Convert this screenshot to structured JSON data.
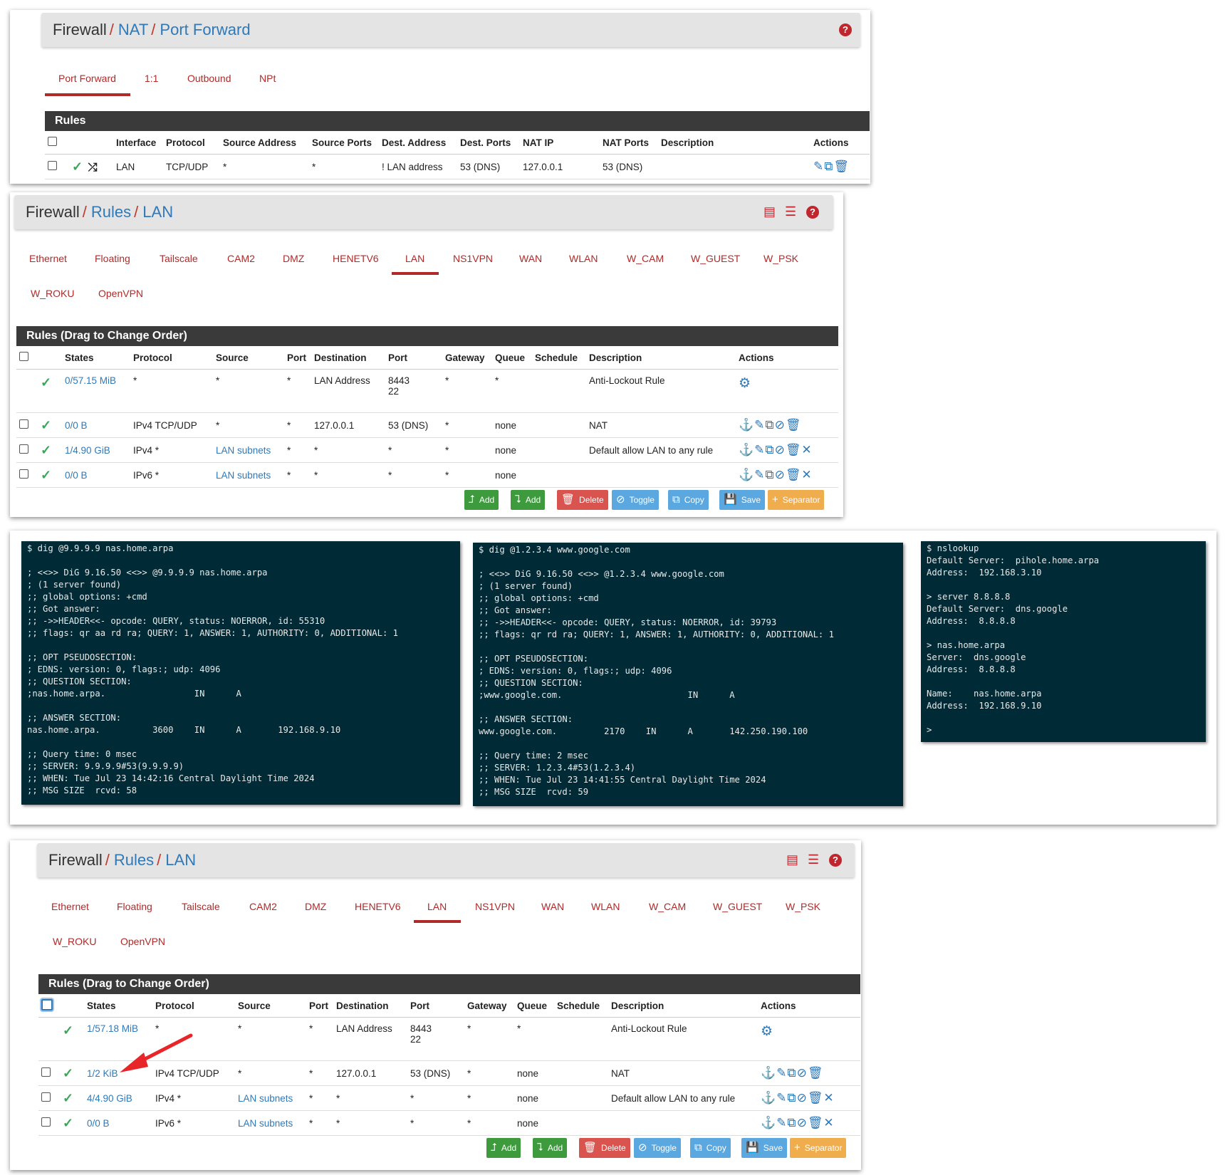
{
  "nat": {
    "crumb": {
      "c1": "Firewall",
      "sep": "/",
      "c2": "NAT",
      "c3": "Port Forward"
    },
    "help": "?",
    "tabs": [
      "Port Forward",
      "1:1",
      "Outbound",
      "NPt"
    ],
    "bar": "Rules",
    "headers": [
      "Interface",
      "Protocol",
      "Source Address",
      "Source Ports",
      "Dest. Address",
      "Dest. Ports",
      "NAT IP",
      "NAT Ports",
      "Description",
      "Actions"
    ],
    "row": {
      "interface": "LAN",
      "protocol": "TCP/UDP",
      "src": "*",
      "sports": "*",
      "dest": "! LAN address",
      "dports": "53 (DNS)",
      "natip": "127.0.0.1",
      "natports": "53 (DNS)",
      "desc": ""
    }
  },
  "lan1": {
    "crumb": {
      "c1": "Firewall",
      "sep": "/",
      "c2": "Rules",
      "c3": "LAN"
    },
    "help": "?",
    "tabs_row1": [
      "Ethernet",
      "Floating",
      "Tailscale",
      "CAM2",
      "DMZ",
      "HENETV6",
      "LAN",
      "NS1VPN",
      "WAN",
      "WLAN",
      "W_CAM",
      "W_GUEST",
      "W_PSK"
    ],
    "tabs_row2": [
      "W_ROKU",
      "OpenVPN"
    ],
    "bar": "Rules (Drag to Change Order)",
    "headers": [
      "States",
      "Protocol",
      "Source",
      "Port",
      "Destination",
      "Port",
      "Gateway",
      "Queue",
      "Schedule",
      "Description",
      "Actions"
    ],
    "rows": [
      {
        "states": "0/57.15 MiB",
        "proto": "*",
        "src": "*",
        "sport": "*",
        "dest": "LAN Address",
        "dport": "8443",
        "dport2": "22",
        "gw": "*",
        "queue": "*",
        "sched": "",
        "desc": "Anti-Lockout Rule"
      },
      {
        "states": "0/0 B",
        "proto": "IPv4 TCP/UDP",
        "src": "*",
        "sport": "*",
        "dest": "127.0.0.1",
        "dport": "53 (DNS)",
        "gw": "*",
        "queue": "none",
        "sched": "",
        "desc": "NAT"
      },
      {
        "states": "1/4.90 GiB",
        "proto": "IPv4 *",
        "src": "LAN subnets",
        "sport": "*",
        "dest": "*",
        "dport": "*",
        "gw": "*",
        "queue": "none",
        "sched": "",
        "desc": "Default allow LAN to any rule"
      },
      {
        "states": "0/0 B",
        "proto": "IPv6 *",
        "src": "LAN subnets",
        "sport": "*",
        "dest": "*",
        "dport": "*",
        "gw": "*",
        "queue": "none",
        "sched": "",
        "desc": ""
      }
    ],
    "buttons": [
      "Add",
      "Add",
      "Delete",
      "Toggle",
      "Copy",
      "Save",
      "Separator"
    ]
  },
  "term1": [
    "$ dig @9.9.9.9 nas.home.arpa",
    "",
    "; <<>> DiG 9.16.50 <<>> @9.9.9.9 nas.home.arpa",
    "; (1 server found)",
    ";; global options: +cmd",
    ";; Got answer:",
    ";; ->>HEADER<<- opcode: QUERY, status: NOERROR, id: 55310",
    ";; flags: qr aa rd ra; QUERY: 1, ANSWER: 1, AUTHORITY: 0, ADDITIONAL: 1",
    "",
    ";; OPT PSEUDOSECTION:",
    "; EDNS: version: 0, flags:; udp: 4096",
    ";; QUESTION SECTION:",
    ";nas.home.arpa.                 IN      A",
    "",
    ";; ANSWER SECTION:",
    "nas.home.arpa.          3600    IN      A       192.168.9.10",
    "",
    ";; Query time: 0 msec",
    ";; SERVER: 9.9.9.9#53(9.9.9.9)",
    ";; WHEN: Tue Jul 23 14:42:16 Central Daylight Time 2024",
    ";; MSG SIZE  rcvd: 58"
  ],
  "term2": [
    "$ dig @1.2.3.4 www.google.com",
    "",
    "; <<>> DiG 9.16.50 <<>> @1.2.3.4 www.google.com",
    "; (1 server found)",
    ";; global options: +cmd",
    ";; Got answer:",
    ";; ->>HEADER<<- opcode: QUERY, status: NOERROR, id: 39793",
    ";; flags: qr rd ra; QUERY: 1, ANSWER: 1, AUTHORITY: 0, ADDITIONAL: 1",
    "",
    ";; OPT PSEUDOSECTION:",
    "; EDNS: version: 0, flags:; udp: 4096",
    ";; QUESTION SECTION:",
    ";www.google.com.                        IN      A",
    "",
    ";; ANSWER SECTION:",
    "www.google.com.         2170    IN      A       142.250.190.100",
    "",
    ";; Query time: 2 msec",
    ";; SERVER: 1.2.3.4#53(1.2.3.4)",
    ";; WHEN: Tue Jul 23 14:41:55 Central Daylight Time 2024",
    ";; MSG SIZE  rcvd: 59"
  ],
  "term3": [
    "$ nslookup",
    "Default Server:  pihole.home.arpa",
    "Address:  192.168.3.10",
    "",
    "> server 8.8.8.8",
    "Default Server:  dns.google",
    "Address:  8.8.8.8",
    "",
    "> nas.home.arpa",
    "Server:  dns.google",
    "Address:  8.8.8.8",
    "",
    "Name:    nas.home.arpa",
    "Address:  192.168.9.10",
    "",
    ">"
  ],
  "lan2": {
    "crumb": {
      "c1": "Firewall",
      "sep": "/",
      "c2": "Rules",
      "c3": "LAN"
    },
    "help": "?",
    "tabs_row1": [
      "Ethernet",
      "Floating",
      "Tailscale",
      "CAM2",
      "DMZ",
      "HENETV6",
      "LAN",
      "NS1VPN",
      "WAN",
      "WLAN",
      "W_CAM",
      "W_GUEST",
      "W_PSK"
    ],
    "tabs_row2": [
      "W_ROKU",
      "OpenVPN"
    ],
    "bar": "Rules (Drag to Change Order)",
    "headers": [
      "States",
      "Protocol",
      "Source",
      "Port",
      "Destination",
      "Port",
      "Gateway",
      "Queue",
      "Schedule",
      "Description",
      "Actions"
    ],
    "rows": [
      {
        "states": "1/57.18 MiB",
        "proto": "*",
        "src": "*",
        "sport": "*",
        "dest": "LAN Address",
        "dport": "8443",
        "dport2": "22",
        "gw": "*",
        "queue": "*",
        "sched": "",
        "desc": "Anti-Lockout Rule"
      },
      {
        "states": "1/2 KiB",
        "proto": "IPv4 TCP/UDP",
        "src": "*",
        "sport": "*",
        "dest": "127.0.0.1",
        "dport": "53 (DNS)",
        "gw": "*",
        "queue": "none",
        "sched": "",
        "desc": "NAT"
      },
      {
        "states": "4/4.90 GiB",
        "proto": "IPv4 *",
        "src": "LAN subnets",
        "sport": "*",
        "dest": "*",
        "dport": "*",
        "gw": "*",
        "queue": "none",
        "sched": "",
        "desc": "Default allow LAN to any rule"
      },
      {
        "states": "0/0 B",
        "proto": "IPv6 *",
        "src": "LAN subnets",
        "sport": "*",
        "dest": "*",
        "dport": "*",
        "gw": "*",
        "queue": "none",
        "sched": "",
        "desc": ""
      }
    ],
    "buttons": [
      "Add",
      "Add",
      "Delete",
      "Toggle",
      "Copy",
      "Save",
      "Separator"
    ]
  },
  "colors": {
    "accent_red": "#b02a2a",
    "link_blue": "#2f79b9",
    "term_bg": "#002b36",
    "ok_green": "#3aa65a",
    "annotation_arrow": "#e8262a"
  }
}
